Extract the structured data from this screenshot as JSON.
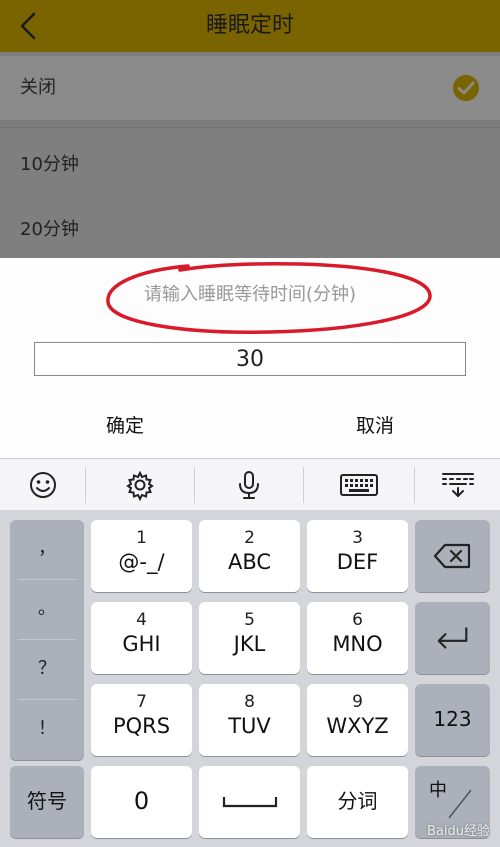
{
  "header": {
    "title": "睡眠定时"
  },
  "options": [
    {
      "label": "关闭",
      "selected": true
    },
    {
      "label": "10分钟",
      "selected": false
    },
    {
      "label": "20分钟",
      "selected": false
    }
  ],
  "dialog": {
    "prompt": "请输入睡眠等待时间(分钟)",
    "input_value": "30",
    "confirm_label": "确定",
    "cancel_label": "取消"
  },
  "toolbar": {
    "icons": [
      "emoji-icon",
      "gear-icon",
      "microphone-icon",
      "keyboard-icon",
      "hide-keyboard-icon"
    ]
  },
  "keyboard": {
    "punctuation": [
      "，",
      "。",
      "？",
      "！"
    ],
    "keys": [
      {
        "num": "1",
        "letters": "@-_/"
      },
      {
        "num": "2",
        "letters": "ABC"
      },
      {
        "num": "3",
        "letters": "DEF"
      },
      {
        "num": "4",
        "letters": "GHI"
      },
      {
        "num": "5",
        "letters": "JKL"
      },
      {
        "num": "6",
        "letters": "MNO"
      },
      {
        "num": "7",
        "letters": "PQRS"
      },
      {
        "num": "8",
        "letters": "TUV"
      },
      {
        "num": "9",
        "letters": "WXYZ"
      }
    ],
    "symbols_label": "符号",
    "zero_label": "0",
    "fenci_label": "分词",
    "num_switch_label": "123",
    "lang_label": "中"
  },
  "colors": {
    "accent": "#f2c200",
    "header_dimmed": "#7a6400",
    "annotation": "#d81a2b"
  },
  "watermark": "Baidu经验"
}
